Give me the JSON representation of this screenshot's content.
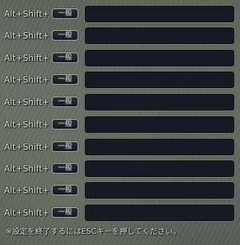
{
  "shortcuts": [
    {
      "prefix": "Alt+Shift+",
      "mode": "一般",
      "value": ""
    },
    {
      "prefix": "Alt+Shift+",
      "mode": "一般",
      "value": ""
    },
    {
      "prefix": "Alt+Shift+",
      "mode": "一般",
      "value": ""
    },
    {
      "prefix": "Alt+Shift+",
      "mode": "一般",
      "value": ""
    },
    {
      "prefix": "Alt+Shift+",
      "mode": "一般",
      "value": ""
    },
    {
      "prefix": "Alt+Shift+",
      "mode": "一般",
      "value": ""
    },
    {
      "prefix": "Alt+Shift+",
      "mode": "一般",
      "value": ""
    },
    {
      "prefix": "Alt+Shift+",
      "mode": "一般",
      "value": ""
    },
    {
      "prefix": "Alt+Shift+",
      "mode": "一般",
      "value": ""
    },
    {
      "prefix": "Alt+Shift+",
      "mode": "一般",
      "value": ""
    }
  ],
  "footer": {
    "note": "※設定を終了するにはESCキーを押してください。"
  },
  "colors": {
    "field_background": "#161a22",
    "field_border": "#8d938a",
    "button_border": "#b9bdb6",
    "text": "#e9ece6"
  }
}
